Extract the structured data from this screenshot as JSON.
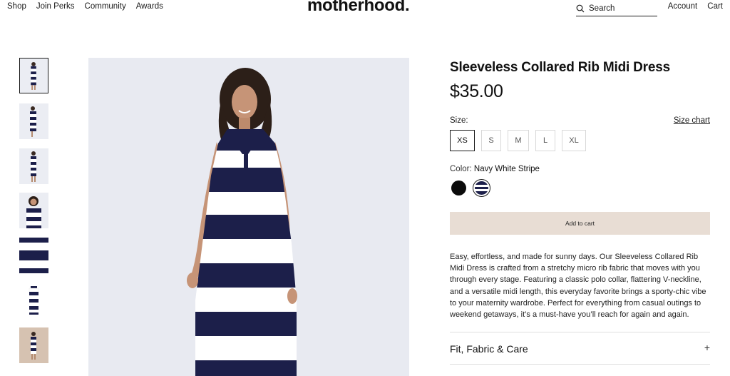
{
  "header": {
    "nav_left": [
      "Shop",
      "Join Perks",
      "Community",
      "Awards"
    ],
    "logo": "motherhood",
    "search_label": "Search",
    "nav_right": [
      "Account",
      "Cart"
    ]
  },
  "product": {
    "title": "Sleeveless Collared Rib Midi Dress",
    "price": "$35.00",
    "size_label": "Size:",
    "size_chart": "Size chart",
    "sizes": [
      "XS",
      "S",
      "M",
      "L",
      "XL"
    ],
    "selected_size": "XS",
    "color_label": "Color:",
    "color_value": "Navy White Stripe",
    "swatches": [
      {
        "name": "Black",
        "color": "#0b0b0b"
      },
      {
        "name": "Navy White Stripe",
        "color": "#1c1f4a"
      }
    ],
    "add_to_cart": "Add to cart",
    "description": "Easy, effortless, and made for sunny days. Our Sleeveless Collared Rib Midi Dress is crafted from a stretchy micro rib fabric that moves with you through every stage. Featuring a classic polo collar, flattering V-neckline, and a versatile midi length, this everyday favorite brings a sporty-chic vibe to your maternity wardrobe. Perfect for everything from casual outings to weekend getaways, it’s a must-have you’ll reach for again and again.",
    "accordion_label": "Fit, Fabric & Care",
    "accordion_icon": "+"
  },
  "colors": {
    "navy": "#1c1f4a",
    "cart_button_bg": "#e8ddd4",
    "image_bg": "#e8eaf1"
  },
  "thumbnails": [
    {
      "name": "full-front",
      "active": true
    },
    {
      "name": "full-side"
    },
    {
      "name": "full-back"
    },
    {
      "name": "upper-body"
    },
    {
      "name": "fabric-detail"
    },
    {
      "name": "flat-lay"
    },
    {
      "name": "lifestyle"
    }
  ]
}
